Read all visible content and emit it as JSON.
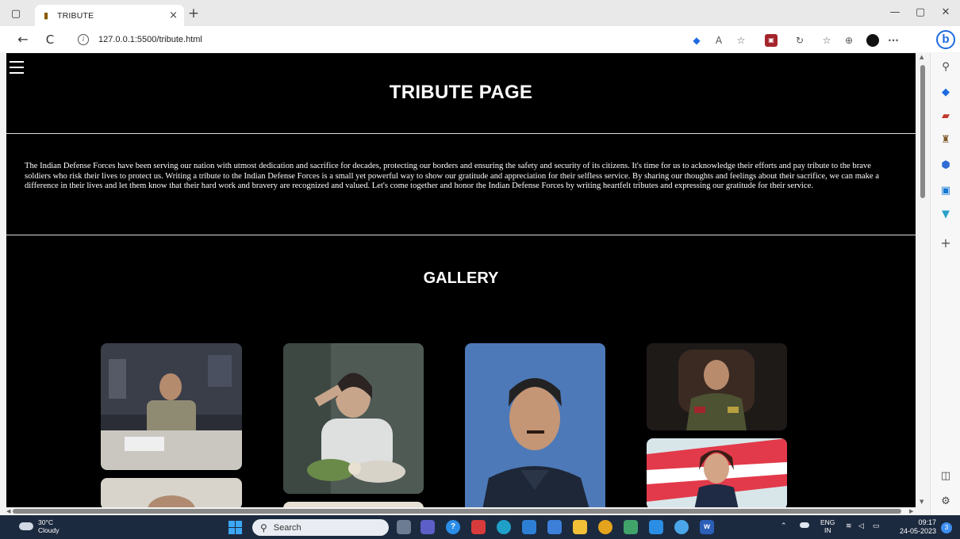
{
  "browser": {
    "tab": {
      "title": "TRIBUTE",
      "close": "×"
    },
    "new_tab": "+",
    "address": {
      "url": "127.0.0.1:5500/tribute.html"
    },
    "window_controls": {
      "minimize": "—",
      "restore": "▢",
      "close": "✕"
    },
    "nav": {
      "back": "←",
      "refresh": "C"
    },
    "toolbar_icons": [
      "tag-icon",
      "read-aloud-icon",
      "favorite-star-icon",
      "extension-icon",
      "performance-icon",
      "favorites-icon",
      "collections-icon",
      "profile-icon",
      "more-icon"
    ],
    "read_aloud_label": "A",
    "more_label": "···",
    "bing_label": "b"
  },
  "page": {
    "title": "TRIBUTE PAGE",
    "intro": "The Indian Defense Forces have been serving our nation with utmost dedication and sacrifice for decades, protecting our borders and ensuring the safety and security of its citizens. It's time for us to acknowledge their efforts and pay tribute to the brave soldiers who risk their lives to protect us. Writing a tribute to the Indian Defense Forces is a small yet powerful way to show our gratitude and appreciation for their selfless service. By sharing our thoughts and feelings about their sacrifice, we can make a difference in their lives and let them know that their hard work and bravery are recognized and valued. Let's come together and honor the Indian Defense Forces by writing heartfelt tributes and expressing our gratitude for their service.",
    "gallery_title": "GALLERY"
  },
  "sidebar": {
    "icons": [
      "search-icon",
      "tag-icon",
      "briefcase-icon",
      "games-icon",
      "office-icon",
      "outlook-icon",
      "drop-icon",
      "add-icon",
      "panel-icon",
      "settings-icon"
    ],
    "add_label": "+"
  },
  "taskbar": {
    "weather": {
      "temp": "30°C",
      "condition": "Cloudy"
    },
    "search_placeholder": "Search",
    "tray": {
      "lang_top": "ENG",
      "lang_bottom": "IN"
    },
    "clock": {
      "time": "09:17",
      "date": "24-05-2023"
    },
    "notifications": "3"
  },
  "colors": {
    "page_bg": "#000000",
    "text": "#ffffff",
    "taskbar": "#1c2a3f",
    "accent": "#1d6be0"
  }
}
